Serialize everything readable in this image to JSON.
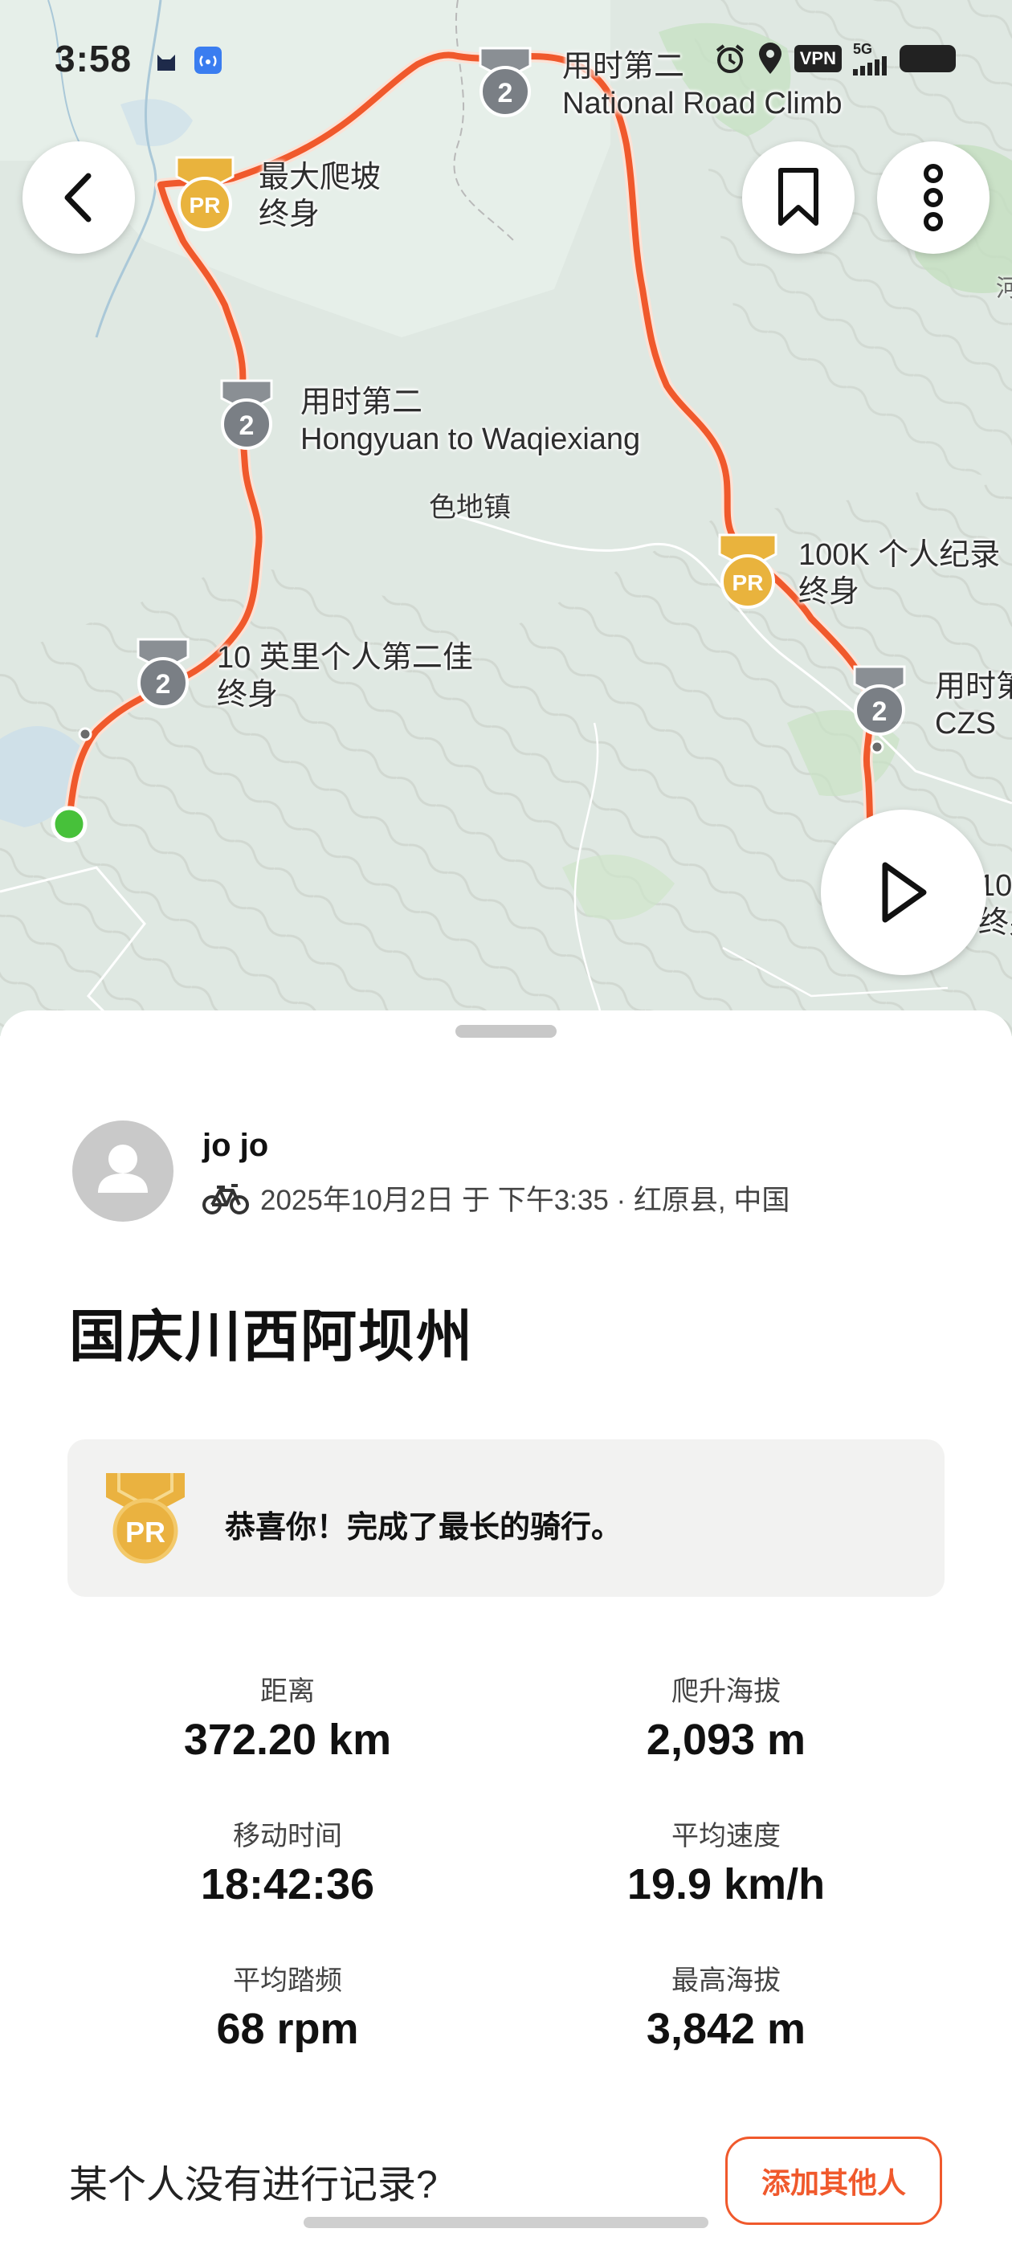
{
  "status_bar": {
    "time": "3:58",
    "vpn": "VPN",
    "network": "5G",
    "icons": [
      "cat-app-icon",
      "hotspot-icon",
      "alarm-icon",
      "location-icon",
      "signal-icon",
      "battery-icon"
    ]
  },
  "map": {
    "segment_labels": [
      {
        "line1": "用时第二",
        "line2": "National Road Climb",
        "badge": "2"
      },
      {
        "line1": "最大爬坡",
        "line2": "终身",
        "badge": "PR"
      },
      {
        "line1": "用时第二",
        "line2": "Hongyuan to Waqiexiang",
        "badge": "2"
      },
      {
        "line1": "100K 个人纪录",
        "line2": "终身",
        "badge": "PR"
      },
      {
        "line1": "10 英里个人第二佳",
        "line2": "终身",
        "badge": "2"
      },
      {
        "line1": "用时第",
        "line2": "CZS",
        "badge": "2"
      },
      {
        "line1": "10",
        "line2": "终身",
        "badge": ""
      }
    ],
    "town_label": "色地镇",
    "edge_label": "河",
    "colors": {
      "route": "#f0592c",
      "start": "#47c13a",
      "pr_badge": "#e9b33d",
      "rank_badge": "#7a7f85"
    }
  },
  "actions": {
    "back_icon": "chevron-left-icon",
    "bookmark_icon": "bookmark-icon",
    "more_icon": "more-vertical-icon",
    "play_icon": "play-icon"
  },
  "athlete": {
    "name": "jo jo",
    "meta": "2025年10月2日 于 下午3:35 · 红原县, 中国",
    "sport_icon": "bike-icon"
  },
  "activity": {
    "title": "国庆川西阿坝州",
    "achievement": "恭喜你！完成了最长的骑行。",
    "achievement_badge": "PR"
  },
  "stats": [
    {
      "label": "距离",
      "value": "372.20 km"
    },
    {
      "label": "爬升海拔",
      "value": "2,093 m"
    },
    {
      "label": "移动时间",
      "value": "18:42:36"
    },
    {
      "label": "平均速度",
      "value": "19.9 km/h"
    },
    {
      "label": "平均踏频",
      "value": "68 rpm"
    },
    {
      "label": "最高海拔",
      "value": "3,842 m"
    }
  ],
  "footer": {
    "question": "某个人没有进行记录?",
    "add_button": "添加其他人"
  },
  "brand": {
    "accent": "#f0592c"
  }
}
